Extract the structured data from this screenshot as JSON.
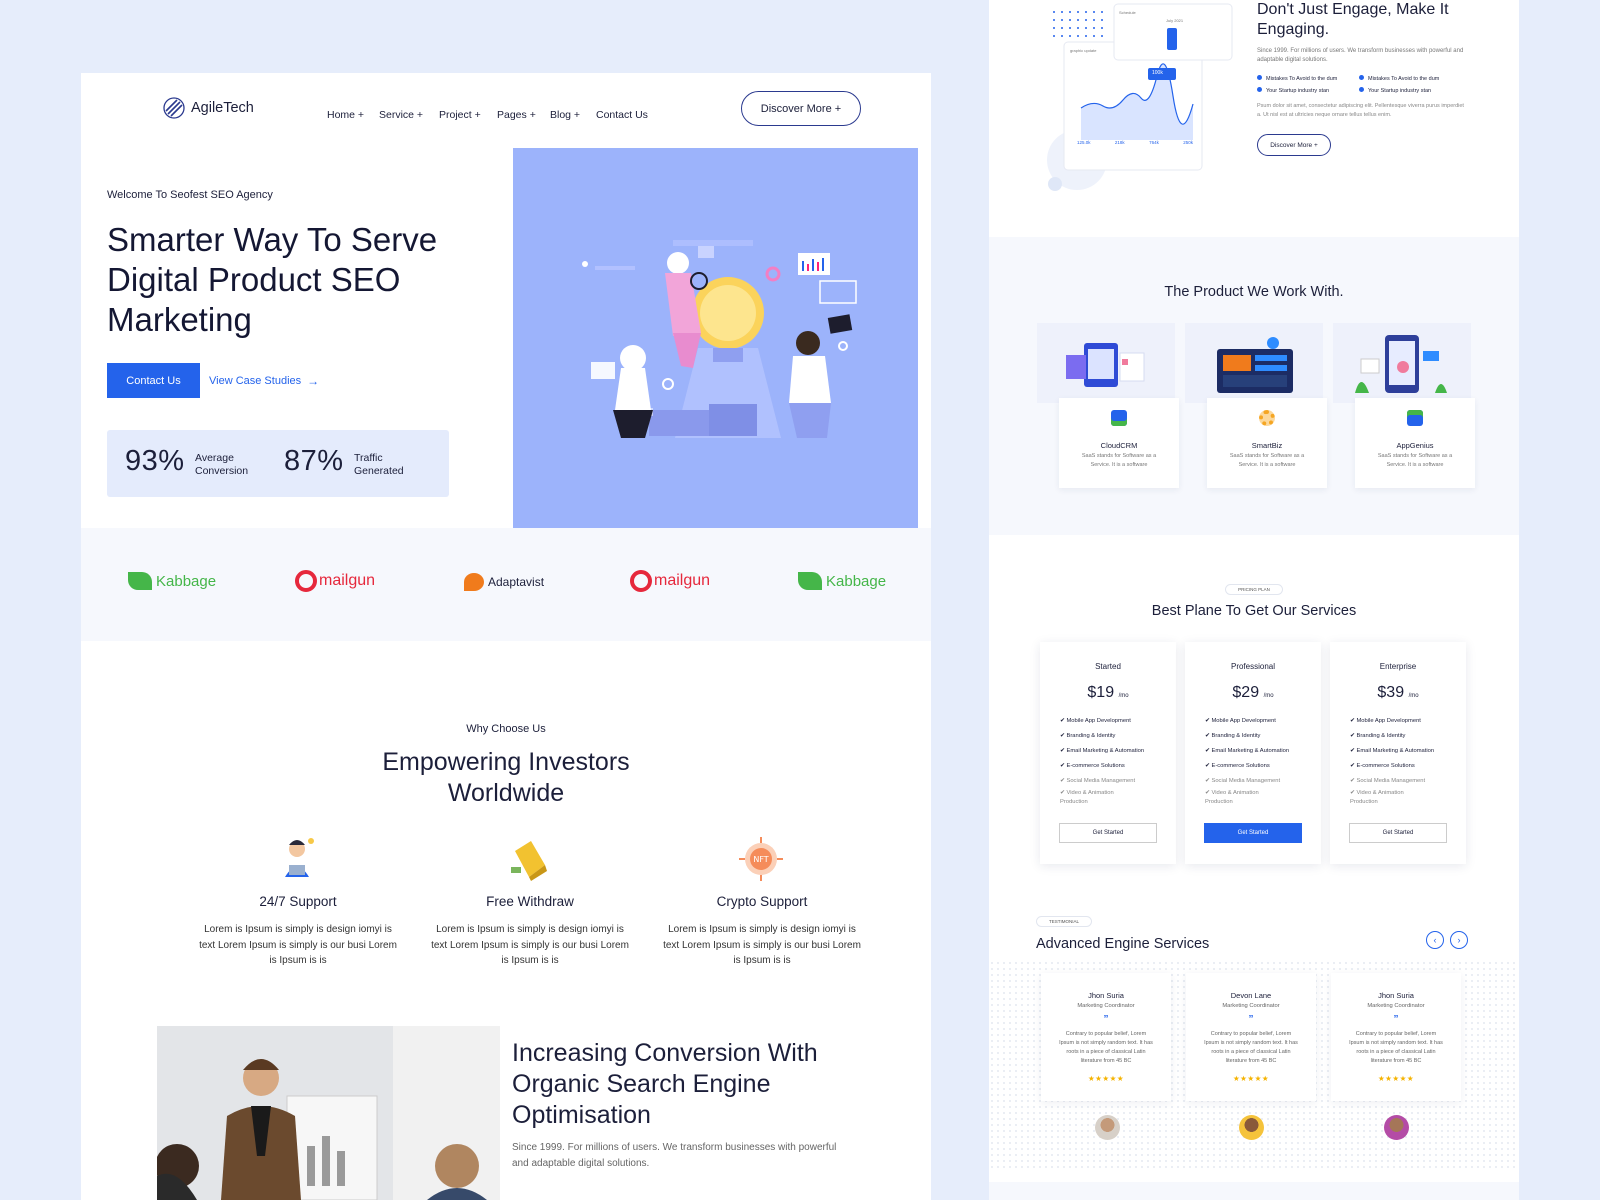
{
  "nav": {
    "logo": "AgileTech",
    "items": [
      "Home +",
      "Service +",
      "Project +",
      "Pages +",
      "Blog +",
      "Contact Us"
    ],
    "cta": "Discover More +"
  },
  "hero": {
    "eyebrow": "Welcome To Seofest SEO Agency",
    "title_lines": [
      "Smarter Way To Serve",
      "Digital Product SEO",
      "Marketing"
    ],
    "primary_button": "Contact Us",
    "secondary_link": "View Case Studies",
    "stats": [
      {
        "value": "93%",
        "label_lines": [
          "Average",
          "Conversion"
        ]
      },
      {
        "value": "87%",
        "label_lines": [
          "Traffic",
          "Generated"
        ]
      }
    ]
  },
  "logos": [
    "Kabbage",
    "mailgun",
    "Adaptavist",
    "mailgun",
    "Kabbage"
  ],
  "why": {
    "eyebrow": "Why Choose Us",
    "title_lines": [
      "Empowering Investors",
      "Worldwide"
    ],
    "features": [
      {
        "icon": "support-person-icon",
        "title": "24/7 Support",
        "desc": "Lorem is Ipsum is simply is design iomyi is text Lorem Ipsum is simply is our busi Lorem is Ipsum is is"
      },
      {
        "icon": "gold-bar-icon",
        "title": "Free Withdraw",
        "desc": "Lorem is Ipsum is simply is design iomyi is text Lorem Ipsum is simply is our busi Lorem is Ipsum is is"
      },
      {
        "icon": "nft-icon",
        "title": "Crypto Support",
        "desc": "Lorem is Ipsum is simply is design iomyi is text Lorem Ipsum is simply is our busi Lorem is Ipsum is is"
      }
    ]
  },
  "conversion": {
    "title_lines": [
      "Increasing Conversion With",
      "Organic Search Engine",
      "Optimisation"
    ],
    "desc": "Since 1999. For millions of users. We transform businesses with powerful and adaptable digital solutions."
  },
  "engage": {
    "title_lines": [
      "Don't Just Engage, Make It",
      "Engaging."
    ],
    "desc": "Since 1999. For millions of users. We transform businesses with powerful and adaptable digital solutions.",
    "bullets": [
      "Mistakes To Avoid to the dum",
      "Mistakes To Avoid to the dum",
      "Your Startup industry stan",
      "Your Startup industry stan"
    ],
    "body": "Psum dolor sit amet, consectetur adipiscing elit. Pellentesque viverra purus imperdiet a. Ut nisl est at ultricies neque ornare tellus tellus enim.",
    "button": "Discover More +",
    "widget": {
      "calendar_title": "July 2021",
      "calendar_label": "Schedule",
      "chart_label": "graphic update",
      "tooltip": "100k",
      "stats": [
        "125.0k",
        "218k",
        "764k",
        "250k"
      ]
    }
  },
  "products": {
    "title": "The Product We Work With.",
    "items": [
      {
        "name": "CloudCRM",
        "desc": "SaaS stands for Software as a Service. It is a software"
      },
      {
        "name": "SmartBiz",
        "desc": "SaaS stands for Software as a Service. It is a software"
      },
      {
        "name": "AppGenius",
        "desc": "SaaS stands for Software as a Service. It is a software"
      }
    ]
  },
  "pricing": {
    "badge": "PRICING PLAN",
    "title": "Best Plane To Get Our Services",
    "plans": [
      {
        "name": "Started",
        "price": "$19",
        "unit": "/mo",
        "button": "Get Started",
        "highlight": false
      },
      {
        "name": "Professional",
        "price": "$29",
        "unit": "/mo",
        "button": "Get Started",
        "highlight": true
      },
      {
        "name": "Enterprise",
        "price": "$39",
        "unit": "/mo",
        "button": "Get Started",
        "highlight": false
      }
    ],
    "features": [
      "Mobile App Development",
      "Branding & Identity",
      "Email Marketing & Automation",
      "E-commerce Solutions",
      "Social Media Management",
      "Video & Animation",
      "Production"
    ]
  },
  "testimonials": {
    "badge": "TESTIMONIAL",
    "title": "Advanced Engine Services",
    "items": [
      {
        "name": "Jhon Suria",
        "role": "Marketing Coordinator",
        "text": "Contrary to popular belief, Lorem Ipsum is not simply random text. It has roots in a piece of classical Latin literature from 45 BC",
        "stars": "★★★★★"
      },
      {
        "name": "Devon Lane",
        "role": "Marketing Coordinator",
        "text": "Contrary to popular belief, Lorem Ipsum is not simply random text. It has roots in a piece of classical Latin literature from 45 BC",
        "stars": "★★★★★"
      },
      {
        "name": "Jhon Suria",
        "role": "Marketing Coordinator",
        "text": "Contrary to popular belief, Lorem Ipsum is not simply random text. It has roots in a piece of classical Latin literature from 45 BC",
        "stars": "★★★★★"
      }
    ]
  },
  "colors": {
    "primary": "#2463eb",
    "hero_image_bg": "#9cb3fb",
    "page_bg": "#e6edfb"
  }
}
